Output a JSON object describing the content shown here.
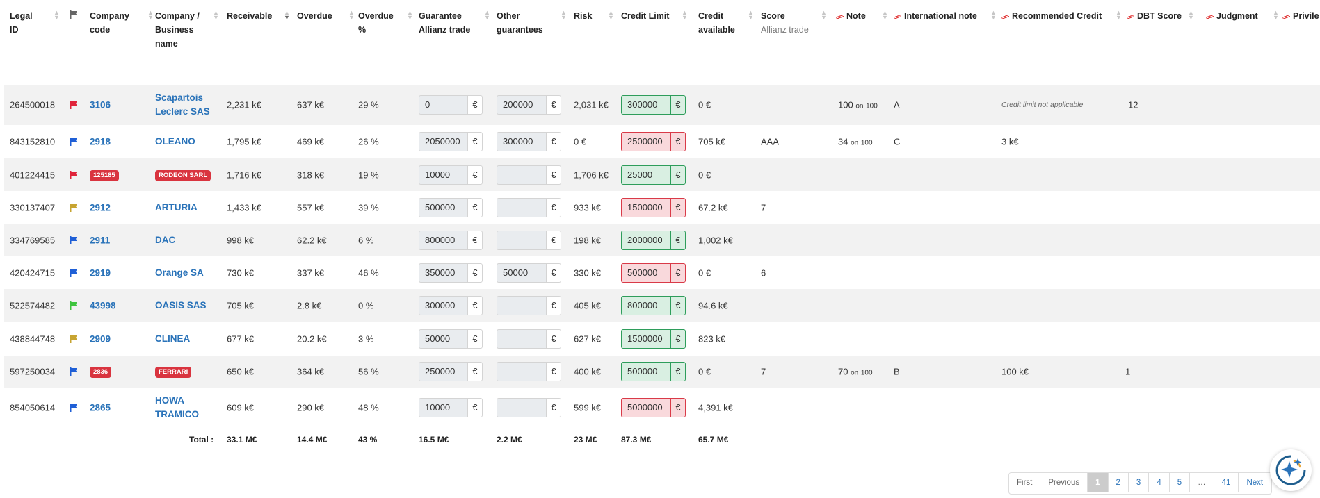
{
  "headers": {
    "legal_id": "Legal\nID",
    "company_code": "Company\ncode",
    "business_name": "Company /\nBusiness\nname",
    "receivable": "Receivable",
    "overdue": "Overdue",
    "overdue_pct": "Overdue\n%",
    "guarantee": "Guarantee\nAllianz trade",
    "other_guarantees": "Other\nguarantees",
    "risk": "Risk",
    "credit_limit": "Credit Limit",
    "credit_available": "Credit\navailable",
    "score": "Score",
    "score_sub": "Allianz trade",
    "note": "Note",
    "international_note": "International note",
    "recommended_credit": "Recommended Credit",
    "dbt_score": "DBT Score",
    "judgment": "Judgment",
    "privileges": "Privile"
  },
  "currency": "€",
  "on_label": "on",
  "colors": {
    "link": "#2a73b9",
    "flag_red": "#e0243a",
    "flag_blue": "#1f5fd6",
    "flag_gold": "#c7a431",
    "flag_green": "#3ec43e",
    "ok": "#2e9d5b",
    "bad": "#d93a48"
  },
  "rows": [
    {
      "legal_id": "264500018",
      "flag": "red",
      "code": "3106",
      "code_badge": false,
      "name": "Scapartois Leclerc SAS",
      "name_badge": false,
      "receivable": "2,231 k€",
      "overdue": "637 k€",
      "overdue_pct": "29 %",
      "guarantee": "0",
      "other": "200000",
      "risk": "2,031 k€",
      "credit_limit": "300000",
      "limit_status": "green",
      "credit_available": "0 €",
      "score": "",
      "note": "100",
      "note_max": "100",
      "intl_note": "A",
      "recommended": "Credit limit not applicable",
      "recommended_italic": true,
      "dbt": "12"
    },
    {
      "legal_id": "843152810",
      "flag": "blue",
      "code": "2918",
      "code_badge": false,
      "name": "OLEANO",
      "name_badge": false,
      "receivable": "1,795 k€",
      "overdue": "469 k€",
      "overdue_pct": "26 %",
      "guarantee": "2050000",
      "other": "300000",
      "risk": "0 €",
      "credit_limit": "2500000",
      "limit_status": "red",
      "credit_available": "705 k€",
      "score": "AAA",
      "note": "34",
      "note_max": "100",
      "intl_note": "C",
      "recommended": "3 k€",
      "recommended_italic": false,
      "dbt": ""
    },
    {
      "legal_id": "401224415",
      "flag": "red",
      "code": "125185",
      "code_badge": true,
      "name": "RODEON SARL",
      "name_badge": true,
      "receivable": "1,716 k€",
      "overdue": "318 k€",
      "overdue_pct": "19 %",
      "guarantee": "10000",
      "other": "",
      "risk": "1,706 k€",
      "credit_limit": "25000",
      "limit_status": "green",
      "credit_available": "0 €",
      "score": "",
      "note": "",
      "note_max": "",
      "intl_note": "",
      "recommended": "",
      "recommended_italic": false,
      "dbt": ""
    },
    {
      "legal_id": "330137407",
      "flag": "gold",
      "code": "2912",
      "code_badge": false,
      "name": "ARTURIA",
      "name_badge": false,
      "receivable": "1,433 k€",
      "overdue": "557 k€",
      "overdue_pct": "39 %",
      "guarantee": "500000",
      "other": "",
      "risk": "933 k€",
      "credit_limit": "1500000",
      "limit_status": "red",
      "credit_available": "67.2 k€",
      "score": "7",
      "note": "",
      "note_max": "",
      "intl_note": "",
      "recommended": "",
      "recommended_italic": false,
      "dbt": ""
    },
    {
      "legal_id": "334769585",
      "flag": "blue",
      "code": "2911",
      "code_badge": false,
      "name": "DAC",
      "name_badge": false,
      "receivable": "998 k€",
      "overdue": "62.2 k€",
      "overdue_pct": "6 %",
      "guarantee": "800000",
      "other": "",
      "risk": "198 k€",
      "credit_limit": "2000000",
      "limit_status": "green",
      "credit_available": "1,002 k€",
      "score": "",
      "note": "",
      "note_max": "",
      "intl_note": "",
      "recommended": "",
      "recommended_italic": false,
      "dbt": ""
    },
    {
      "legal_id": "420424715",
      "flag": "blue",
      "code": "2919",
      "code_badge": false,
      "name": "Orange SA",
      "name_badge": false,
      "receivable": "730 k€",
      "overdue": "337 k€",
      "overdue_pct": "46 %",
      "guarantee": "350000",
      "other": "50000",
      "risk": "330 k€",
      "credit_limit": "500000",
      "limit_status": "red",
      "credit_available": "0 €",
      "score": "6",
      "note": "",
      "note_max": "",
      "intl_note": "",
      "recommended": "",
      "recommended_italic": false,
      "dbt": ""
    },
    {
      "legal_id": "522574482",
      "flag": "green",
      "code": "43998",
      "code_badge": false,
      "name": "OASIS SAS",
      "name_badge": false,
      "receivable": "705 k€",
      "overdue": "2.8 k€",
      "overdue_pct": "0 %",
      "guarantee": "300000",
      "other": "",
      "risk": "405 k€",
      "credit_limit": "800000",
      "limit_status": "green",
      "credit_available": "94.6 k€",
      "score": "",
      "note": "",
      "note_max": "",
      "intl_note": "",
      "recommended": "",
      "recommended_italic": false,
      "dbt": ""
    },
    {
      "legal_id": "438844748",
      "flag": "gold",
      "code": "2909",
      "code_badge": false,
      "name": "CLINEA",
      "name_badge": false,
      "receivable": "677 k€",
      "overdue": "20.2 k€",
      "overdue_pct": "3 %",
      "guarantee": "50000",
      "other": "",
      "risk": "627 k€",
      "credit_limit": "1500000",
      "limit_status": "green",
      "credit_available": "823 k€",
      "score": "",
      "note": "",
      "note_max": "",
      "intl_note": "",
      "recommended": "",
      "recommended_italic": false,
      "dbt": ""
    },
    {
      "legal_id": "597250034",
      "flag": "blue",
      "code": "2836",
      "code_badge": true,
      "name": "FERRARI",
      "name_badge": true,
      "receivable": "650 k€",
      "overdue": "364 k€",
      "overdue_pct": "56 %",
      "guarantee": "250000",
      "other": "",
      "risk": "400 k€",
      "credit_limit": "500000",
      "limit_status": "green",
      "credit_available": "0 €",
      "score": "7",
      "note": "70",
      "note_max": "100",
      "intl_note": "B",
      "recommended": "100 k€",
      "recommended_italic": false,
      "dbt": "1"
    },
    {
      "legal_id": "854050614",
      "flag": "blue",
      "code": "2865",
      "code_badge": false,
      "name": "HOWA TRAMICO",
      "name_badge": false,
      "receivable": "609 k€",
      "overdue": "290 k€",
      "overdue_pct": "48 %",
      "guarantee": "10000",
      "other": "",
      "risk": "599 k€",
      "credit_limit": "5000000",
      "limit_status": "red",
      "credit_available": "4,391 k€",
      "score": "",
      "note": "",
      "note_max": "",
      "intl_note": "",
      "recommended": "",
      "recommended_italic": false,
      "dbt": ""
    }
  ],
  "totals": {
    "label": "Total :",
    "receivable": "33.1 M€",
    "overdue": "14.4 M€",
    "overdue_pct": "43 %",
    "guarantee": "16.5 M€",
    "other": "2.2 M€",
    "risk": "23 M€",
    "credit_limit": "87.3 M€",
    "credit_available": "65.7 M€"
  },
  "pagination": {
    "first": "First",
    "previous": "Previous",
    "pages": [
      "1",
      "2",
      "3",
      "4",
      "5",
      "…",
      "41"
    ],
    "current": "1",
    "next": "Next"
  },
  "icons": {
    "flag": "flag-icon",
    "assistant": "sparkle-assistant-icon",
    "sort": "sort-icon"
  }
}
